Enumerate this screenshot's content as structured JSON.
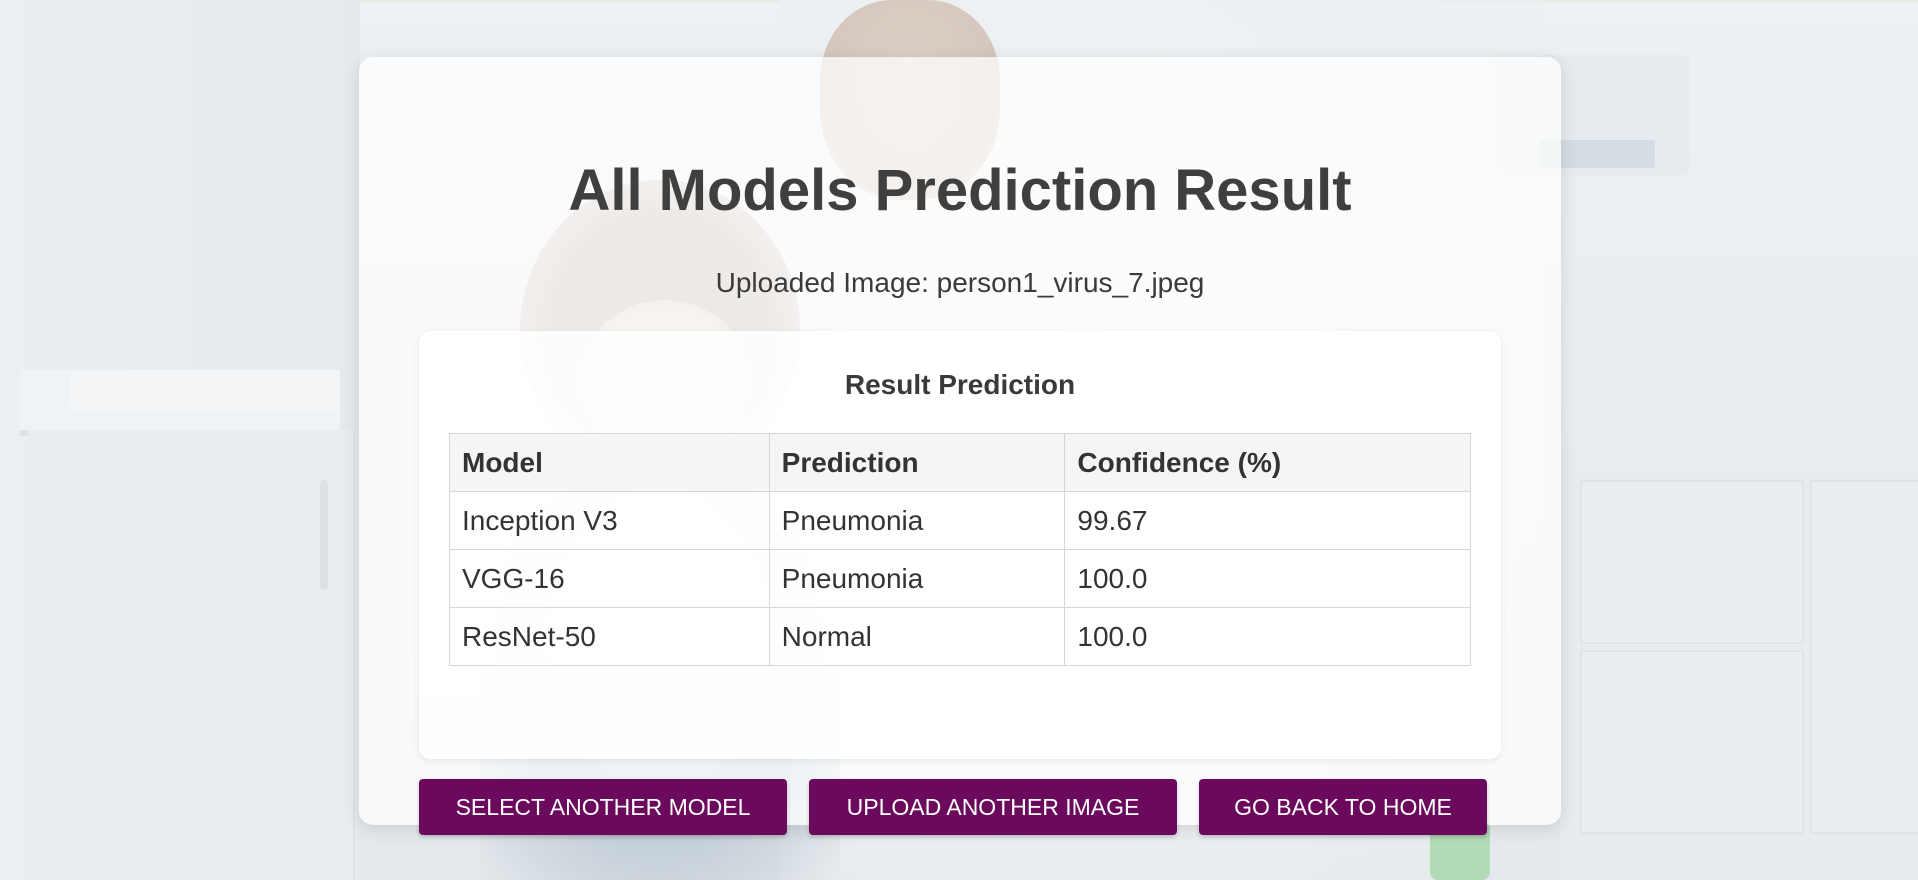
{
  "page": {
    "title": "All Models Prediction Result",
    "uploaded_label": "Uploaded Image: person1_virus_7.jpeg"
  },
  "result": {
    "heading": "Result Prediction",
    "columns": [
      "Model",
      "Prediction",
      "Confidence (%)"
    ],
    "rows": [
      {
        "model": "Inception V3",
        "prediction": "Pneumonia",
        "confidence": "99.67"
      },
      {
        "model": "VGG-16",
        "prediction": "Pneumonia",
        "confidence": "100.0"
      },
      {
        "model": "ResNet-50",
        "prediction": "Normal",
        "confidence": "100.0"
      }
    ]
  },
  "actions": {
    "select_model": "SELECT ANOTHER MODEL",
    "upload_image": "UPLOAD ANOTHER IMAGE",
    "go_home": "GO BACK TO HOME"
  },
  "colors": {
    "button_bg": "#6b0a5c",
    "title_text": "#3f3f3f"
  }
}
